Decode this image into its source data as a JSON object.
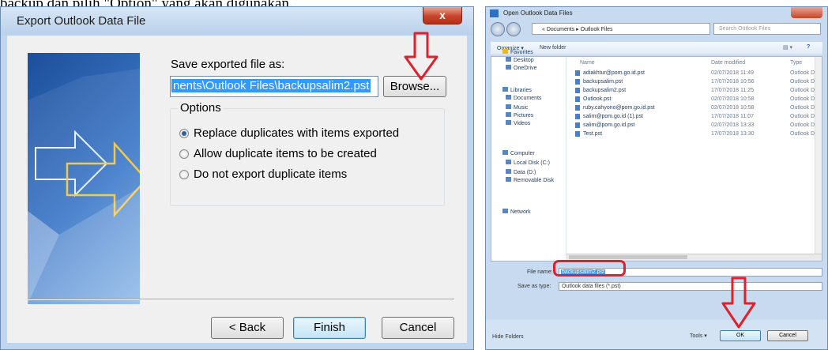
{
  "top_text": "backup dan pilih \"Option\" yang akan digunakan.",
  "export_dialog": {
    "title": "Export Outlook Data File",
    "close_glyph": "x",
    "save_label": "Save exported file as:",
    "path_value": "nents\\Outlook Files\\backupsalim2.pst",
    "browse_label": "Browse...",
    "options_label": "Options",
    "options": [
      {
        "label": "Replace duplicates with items exported",
        "selected": true
      },
      {
        "label": "Allow duplicate items to be created",
        "selected": false
      },
      {
        "label": "Do not export duplicate items",
        "selected": false
      }
    ],
    "back_label": "< Back",
    "finish_label": "Finish",
    "cancel_label": "Cancel"
  },
  "open_dialog": {
    "title": "Open Outlook Data Files",
    "breadcrumb": "« Documents ▸ Outlook Files",
    "search_placeholder": "Search Outlook Files",
    "organize_label": "Organize ▾",
    "new_folder_label": "New folder",
    "columns": [
      "Name",
      "Date modified",
      "Type"
    ],
    "nav_items": [
      {
        "label": "Favorites",
        "icon": "star-icon"
      },
      {
        "label": "Desktop",
        "icon": "desktop-icon"
      },
      {
        "label": "OneDrive",
        "icon": "cloud-icon"
      },
      {
        "label": "Libraries",
        "icon": "library-icon"
      },
      {
        "label": "Documents",
        "icon": "document-icon"
      },
      {
        "label": "Music",
        "icon": "music-icon"
      },
      {
        "label": "Pictures",
        "icon": "picture-icon"
      },
      {
        "label": "Videos",
        "icon": "video-icon"
      },
      {
        "label": "Computer",
        "icon": "computer-icon"
      },
      {
        "label": "Local Disk (C:)",
        "icon": "disk-icon"
      },
      {
        "label": "Data (D:)",
        "icon": "disk-icon"
      },
      {
        "label": "Removable Disk",
        "icon": "removable-disk-icon"
      },
      {
        "label": "Network",
        "icon": "network-icon"
      }
    ],
    "files": [
      {
        "name": "adiakhtur@pom.go.id.pst",
        "date": "02/07/2018 11:49",
        "type": "Outlook D"
      },
      {
        "name": "backupsalim.pst",
        "date": "17/07/2018 10:56",
        "type": "Outlook D"
      },
      {
        "name": "backupsalim2.pst",
        "date": "17/07/2018 11:25",
        "type": "Outlook D"
      },
      {
        "name": "Outlook.pst",
        "date": "02/07/2018 10:58",
        "type": "Outlook D"
      },
      {
        "name": "ruby.cahyono@pom.go.id.pst",
        "date": "02/07/2018 10:58",
        "type": "Outlook D"
      },
      {
        "name": "salim@pom.go.id (1).pst",
        "date": "17/07/2018 11:07",
        "type": "Outlook D"
      },
      {
        "name": "salim@pom.go.id.pst",
        "date": "02/07/2018 13:33",
        "type": "Outlook D"
      },
      {
        "name": "Test.pst",
        "date": "17/07/2018 13:30",
        "type": "Outlook D"
      }
    ],
    "file_name_label": "File name:",
    "file_name_value": "backupsalim2.pst",
    "save_type_label": "Save as type:",
    "save_type_value": "Outlook data files (*.pst)",
    "hide_folders_label": "Hide Folders",
    "tools_label": "Tools ▾",
    "ok_label": "OK",
    "cancel_label": "Cancel"
  },
  "colors": {
    "highlight": "#3399ff",
    "annotation_red": "#e0202a"
  }
}
